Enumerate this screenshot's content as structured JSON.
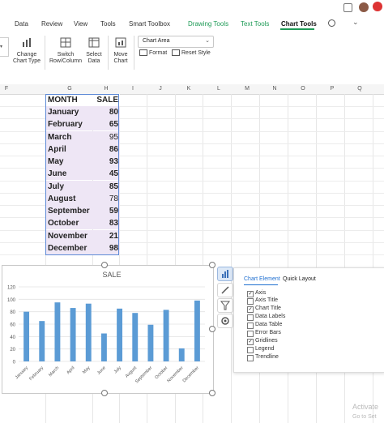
{
  "tabs": [
    {
      "label": "Data",
      "style": "normal"
    },
    {
      "label": "Review",
      "style": "normal"
    },
    {
      "label": "View",
      "style": "normal"
    },
    {
      "label": "Tools",
      "style": "normal"
    },
    {
      "label": "Smart Toolbox",
      "style": "normal"
    },
    {
      "label": "Drawing Tools",
      "style": "green"
    },
    {
      "label": "Text Tools",
      "style": "green"
    },
    {
      "label": "Chart Tools",
      "style": "active"
    }
  ],
  "ribbon": {
    "change_chart_type": "Change Chart Type",
    "switch_row_column": "Switch Row/Column",
    "select_data": "Select Data",
    "move_chart": "Move Chart",
    "chart_element_select": "Chart Area",
    "format": "Format",
    "reset_style": "Reset Style"
  },
  "columns": [
    "F",
    "G",
    "H",
    "I",
    "J",
    "K",
    "L",
    "M",
    "N",
    "O",
    "P",
    "Q"
  ],
  "table": {
    "header": [
      "MONTH",
      "SALE"
    ],
    "rows": [
      [
        "January",
        "80"
      ],
      [
        "February",
        "65"
      ],
      [
        "March",
        "95"
      ],
      [
        "April",
        "86"
      ],
      [
        "May",
        "93"
      ],
      [
        "June",
        "45"
      ],
      [
        "July",
        "85"
      ],
      [
        "August",
        "78"
      ],
      [
        "September",
        "59"
      ],
      [
        "October",
        "83"
      ],
      [
        "November",
        "21"
      ],
      [
        "December",
        "98"
      ]
    ]
  },
  "chart_data": {
    "type": "bar",
    "title": "SALE",
    "categories": [
      "January",
      "February",
      "March",
      "April",
      "May",
      "June",
      "July",
      "August",
      "September",
      "October",
      "November",
      "December"
    ],
    "values": [
      80,
      65,
      95,
      86,
      93,
      45,
      85,
      78,
      59,
      83,
      21,
      98
    ],
    "ylim": [
      0,
      120
    ],
    "yticks": [
      0,
      20,
      40,
      60,
      80,
      100,
      120
    ],
    "grid": true,
    "bar_color": "#5b9bd5"
  },
  "popup": {
    "tabs": [
      "Chart Element",
      "Quick Layout"
    ],
    "options": [
      {
        "label": "Axis",
        "checked": true
      },
      {
        "label": "Axis Title",
        "checked": false
      },
      {
        "label": "Chart Title",
        "checked": true
      },
      {
        "label": "Data Labels",
        "checked": false
      },
      {
        "label": "Data Table",
        "checked": false
      },
      {
        "label": "Error Bars",
        "checked": false
      },
      {
        "label": "Gridlines",
        "checked": true
      },
      {
        "label": "Legend",
        "checked": false
      },
      {
        "label": "Trendline",
        "checked": false
      }
    ]
  },
  "watermark": {
    "line1": "Activate",
    "line2": "Go to Set"
  },
  "colors": {
    "accent_green": "#1f9b57",
    "table_fill": "#eee6f5",
    "table_border": "#5d8ad6",
    "popup_tab_active": "#1f6fd0"
  },
  "icons": [
    "change-chart-type-icon",
    "switch-row-column-icon",
    "select-data-icon",
    "move-chart-icon",
    "format-icon",
    "reset-style-icon",
    "chart-elements-icon",
    "chart-style-icon",
    "chart-filter-icon",
    "chart-settings-icon",
    "cursor-icon"
  ]
}
